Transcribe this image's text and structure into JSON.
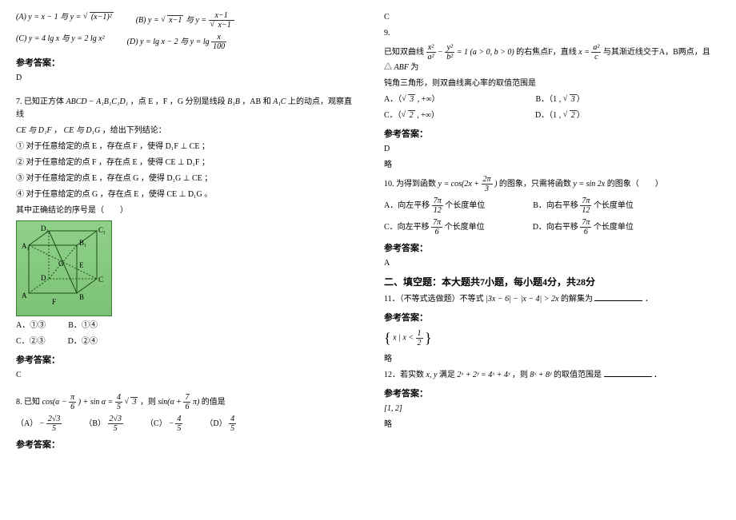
{
  "left": {
    "q6": {
      "A_left": "(A) y = x − 1 与 y =",
      "A_sqrt": "(x−1)²",
      "B_left": "(B) y =",
      "B_sqrt1": "x−1",
      "B_mid": " 与 y =",
      "B_num": "x−1",
      "B_den": "x−1",
      "C": "(C) y = 4 lg x 与 y = 2 lg x²",
      "D_left": "(D) y = lg x − 2 与 y = lg",
      "D_num": "x",
      "D_den": "100"
    },
    "ans_label": "参考答案：",
    "q6ans": "D",
    "q7": {
      "stem1_a": "7. 已知正方体 ",
      "stem1_cube": "ABCD − A₁B₁C₁D₁",
      "stem1_b": "，点 E ，F ，G 分别是线段 ",
      "stem1_seg1": "B₁B",
      "stem1_c": "，AB 和 ",
      "stem1_seg2": "A₁C",
      "stem1_d": " 上的动点，观察直线",
      "stem2_a": "CE 与 D₁F",
      "stem2_b": "，",
      "stem2_c": "CE 与 D₁G",
      "stem2_d": "，给出下列结论：",
      "s1": "① 对于任意给定的点 E ，存在点 F ，使得 D₁F ⊥ CE ；",
      "s2": "② 对于任意给定的点 F ，存在点 E ，使得 CE ⊥ D₁F ；",
      "s3": "③ 对于任意给定的点 E ，存在点 G ，使得 D₁G ⊥ CE ；",
      "s4": "④ 对于任意给定的点 G ，存在点 E ，使得 CE ⊥ D₁G 。",
      "conclude": "其中正确结论的序号是（　　）",
      "A": "A．①③",
      "B": "B．①④",
      "C": "C．②③",
      "D": "D．②④"
    },
    "q7ans": "C",
    "q8": {
      "lead": "8. 已知 ",
      "cos_arg_a": "cos(α −",
      "cos_arg_num": "π",
      "cos_arg_den": "6",
      "cos_arg_b": ") + sin α =",
      "rhs_num": "4",
      "rhs_den": "5",
      "rhs_sqrt": "3",
      "then": " ，则 ",
      "sin_arg_a": "sin(α +",
      "sin_arg_num": "7",
      "sin_arg_den": "6",
      "sin_arg_c": "π)",
      "tail": " 的值是",
      "A_label": "（A） −",
      "A_num": "2√3",
      "A_den": "5",
      "B_label": "（B） ",
      "B_num": "2√3",
      "B_den": "5",
      "C_label": "（C） −",
      "C_num": "4",
      "C_den": "5",
      "D_label": "（D） ",
      "D_num": "4",
      "D_den": "5"
    }
  },
  "right": {
    "q8ans": "C",
    "q9": {
      "num": "9.",
      "stem_a": "已知双曲线",
      "hy_num1": "x²",
      "hy_den1": "a²",
      "hy_minus": " − ",
      "hy_num2": "y²",
      "hy_den2": "b²",
      "hy_eq": " = 1 (a > 0, b > 0)",
      "stem_b": " 的右焦点F，直线 ",
      "line_left": "x =",
      "line_num": "a²",
      "line_den": "c",
      "stem_c": " 与其渐近线交于A，B两点，且 △",
      "tri": "ABF",
      "stem_d": " 为",
      "stem2": "钝角三角形，则双曲线离心率的取值范围是",
      "A_label": "A．（",
      "A_sqrt": "3",
      "A_tail": " , +∞）",
      "B_label": "B．（1 , ",
      "B_sqrt": "3",
      "B_tail": "）",
      "C_label": "C．（",
      "C_sqrt": "2",
      "C_tail": " , +∞）",
      "D_label": "D．（1 , ",
      "D_sqrt": "2",
      "D_tail": "）"
    },
    "q9ans": "D",
    "lue": "略",
    "q10": {
      "stem_a": "10. 为得到函数 ",
      "f_left": "y = cos(2x +",
      "f_num": "2π",
      "f_den": "3",
      "f_right": ")",
      "stem_b": " 的图象，只需将函数 ",
      "g": "y = sin 2x",
      "stem_c": " 的图象（　　）",
      "A_a": "A．向左平移",
      "A_num": "7π",
      "A_den": "12",
      "A_b": " 个长度单位",
      "B_a": "B．向右平移",
      "B_num": "7π",
      "B_den": "12",
      "B_b": " 个长度单位",
      "C_a": "C．向左平移",
      "C_num": "7π",
      "C_den": "6",
      "C_b": " 个长度单位",
      "D_a": "D．向右平移",
      "D_num": "7π",
      "D_den": "6",
      "D_b": " 个长度单位"
    },
    "q10ans": "A",
    "section2": "二、填空题：本大题共7小题，每小题4分，共28分",
    "q11": {
      "stem_a": "11．（不等式选做题）不等式 ",
      "expr": "|3x − 6| − |x − 4| > 2x",
      "stem_b": " 的解集为",
      "tail": "．",
      "ans_a": "x | x <",
      "ans_num": "1",
      "ans_den": "2"
    },
    "q12": {
      "stem_a": "12．若实数 ",
      "xy": "x, y",
      "stem_b": " 满足 ",
      "cond": "2ˣ + 2ʸ = 4ˣ + 4ʸ",
      "stem_c": "，则 ",
      "target": "8ˣ + 8ʸ",
      "stem_d": " 的取值范围是",
      "tail": "．",
      "ans": "[1, 2]"
    }
  },
  "labels": {
    "ans": "参考答案：",
    "lue": "略"
  }
}
